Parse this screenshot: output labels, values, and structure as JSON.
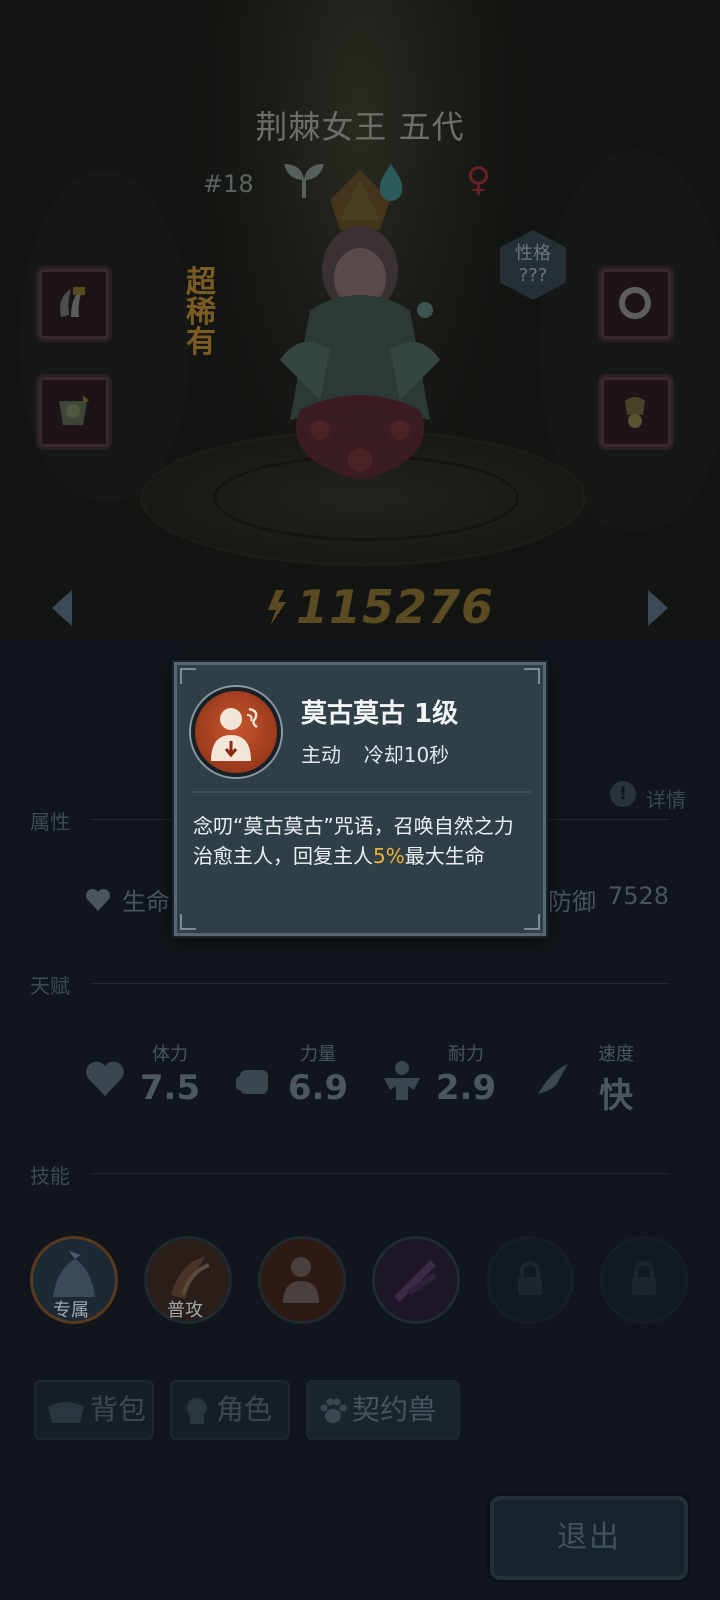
{
  "hero": {
    "name": "荆棘女王 五代",
    "id_label": "#18",
    "gender_symbol": "♀",
    "rarity": "超稀有",
    "trait_label": "性格",
    "trait_value": "???",
    "power": "115276"
  },
  "sections": {
    "attributes_title": "属性",
    "details_label": "详情",
    "talent_title": "天赋",
    "skills_title": "技能"
  },
  "stats": {
    "hp_label": "生命",
    "def_label": "防御",
    "def_value": "7528"
  },
  "talents": [
    {
      "name": "体力",
      "value": "7.5",
      "icon": "heart-icon"
    },
    {
      "name": "力量",
      "value": "6.9",
      "icon": "fist-icon"
    },
    {
      "name": "耐力",
      "value": "2.9",
      "icon": "muscle-icon"
    },
    {
      "name": "速度",
      "value": "快",
      "icon": "wing-icon"
    }
  ],
  "skills": [
    {
      "label": "专属",
      "icon": "exclusive-skill-icon"
    },
    {
      "label": "普攻",
      "icon": "basic-attack-icon"
    },
    {
      "label": "",
      "icon": "mogu-mogu-skill-icon"
    },
    {
      "label": "",
      "icon": "thorn-skill-icon"
    },
    {
      "label": "",
      "icon": "lock-icon"
    },
    {
      "label": "",
      "icon": "lock-icon"
    }
  ],
  "tabs": [
    {
      "label": "背包",
      "icon": "bag-icon"
    },
    {
      "label": "角色",
      "icon": "character-icon"
    },
    {
      "label": "契约兽",
      "icon": "paw-icon"
    }
  ],
  "exit_label": "退出",
  "popup": {
    "title": "莫古莫古 1级",
    "type": "主动",
    "cooldown": "冷却10秒",
    "desc_before": "念叨“莫古莫古”咒语，召唤自然之力治愈主人，回复主人",
    "desc_highlight": "5%",
    "desc_after": "最大生命",
    "highlight_color": "#f0b030"
  }
}
